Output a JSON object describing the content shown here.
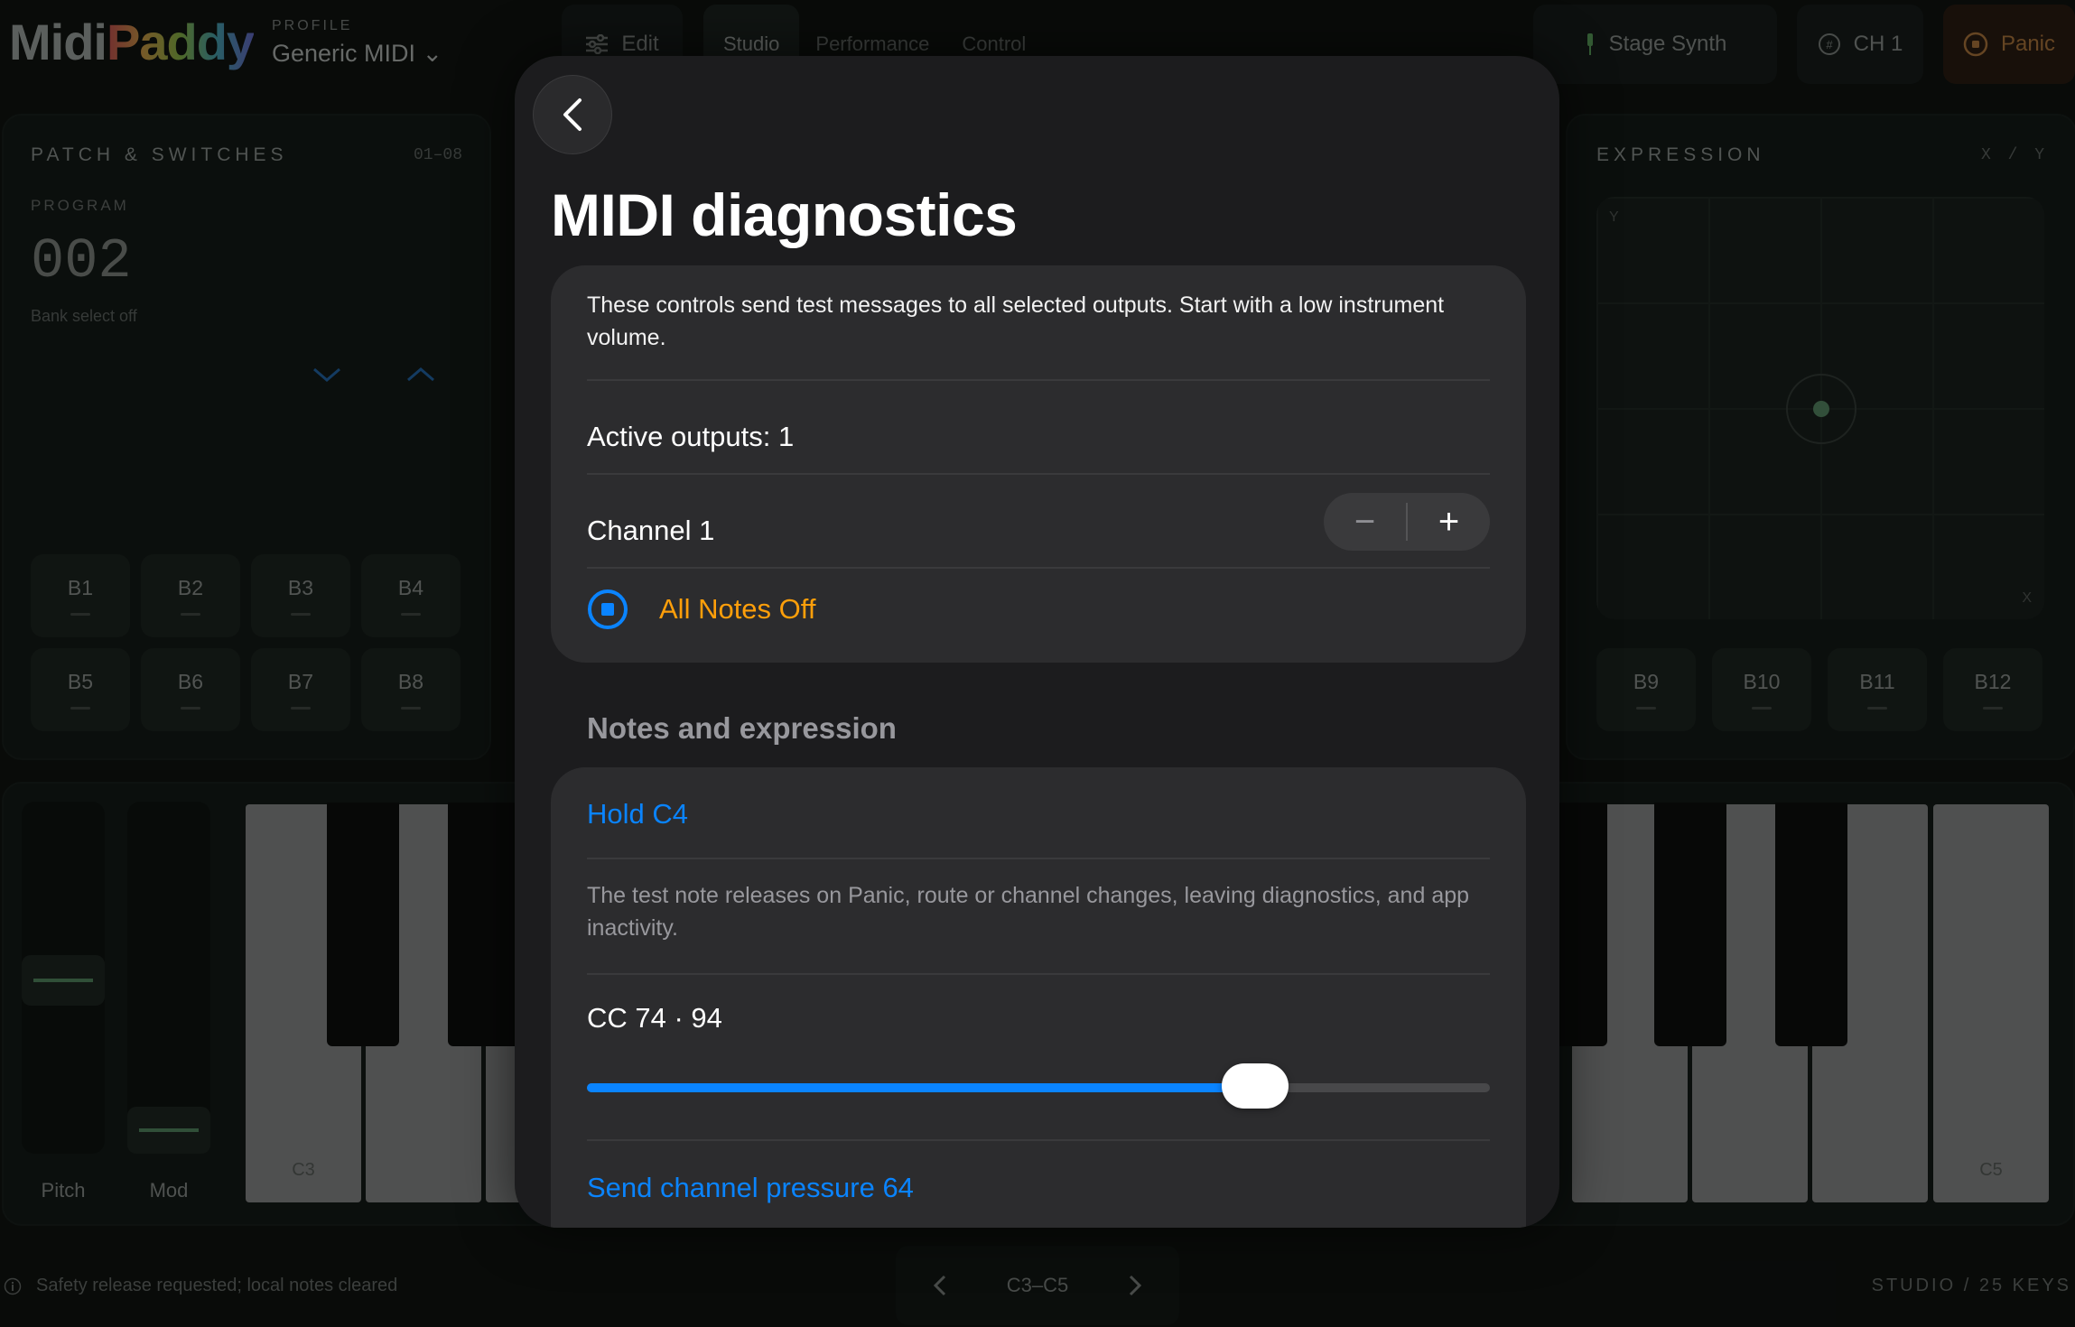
{
  "app": {
    "logo_part1": "Midi",
    "logo_part2": "Paddy",
    "profile_label": "PROFILE",
    "profile_value": "Generic MIDI ⌄",
    "toolbar": {
      "edit_label": "Edit",
      "modes": [
        "Studio",
        "Performance",
        "Control"
      ],
      "active_mode": "Studio",
      "instrument": "Stage Synth",
      "channel": "CH 1",
      "panic": "Panic"
    },
    "patch_panel": {
      "title": "PATCH & SWITCHES",
      "range": "01–08",
      "program_label": "PROGRAM",
      "program_value": "002",
      "bank_status": "Bank select off",
      "buttons": [
        "B1",
        "B2",
        "B3",
        "B4",
        "B5",
        "B6",
        "B7",
        "B8"
      ]
    },
    "expression_panel": {
      "title": "EXPRESSION",
      "axes": "X / Y",
      "y_label": "Y",
      "x_label": "X",
      "buttons": [
        "B9",
        "B10",
        "B11",
        "B12"
      ]
    },
    "wheels": {
      "pitch": "Pitch",
      "mod": "Mod"
    },
    "keyboard": {
      "low_label": "C3",
      "high_label": "C5"
    },
    "footer": {
      "status": "Safety release requested; local notes cleared",
      "range": "C3–C5",
      "mode": "STUDIO / 25 KEYS"
    }
  },
  "modal": {
    "title": "MIDI diagnostics",
    "intro": "These controls send test messages to all selected outputs. Start with a low instrument volume.",
    "active_outputs": "Active outputs: 1",
    "channel": "Channel 1",
    "stepper_minus": "−",
    "stepper_plus": "+",
    "all_notes_off": "All Notes Off",
    "section_notes": "Notes and expression",
    "hold_note": "Hold C4",
    "hold_note_help": "The test note releases on Panic, route or channel changes, leaving diagnostics, and app inactivity.",
    "cc_label": "CC 74 · 94",
    "cc_value": 94,
    "cc_max": 127,
    "pressure": "Send channel pressure 64"
  },
  "colors": {
    "accent_blue": "#0a84ff",
    "accent_orange": "#ff9f0a",
    "modal_bg": "#1c1c1e",
    "card_bg": "#2c2c2e"
  }
}
